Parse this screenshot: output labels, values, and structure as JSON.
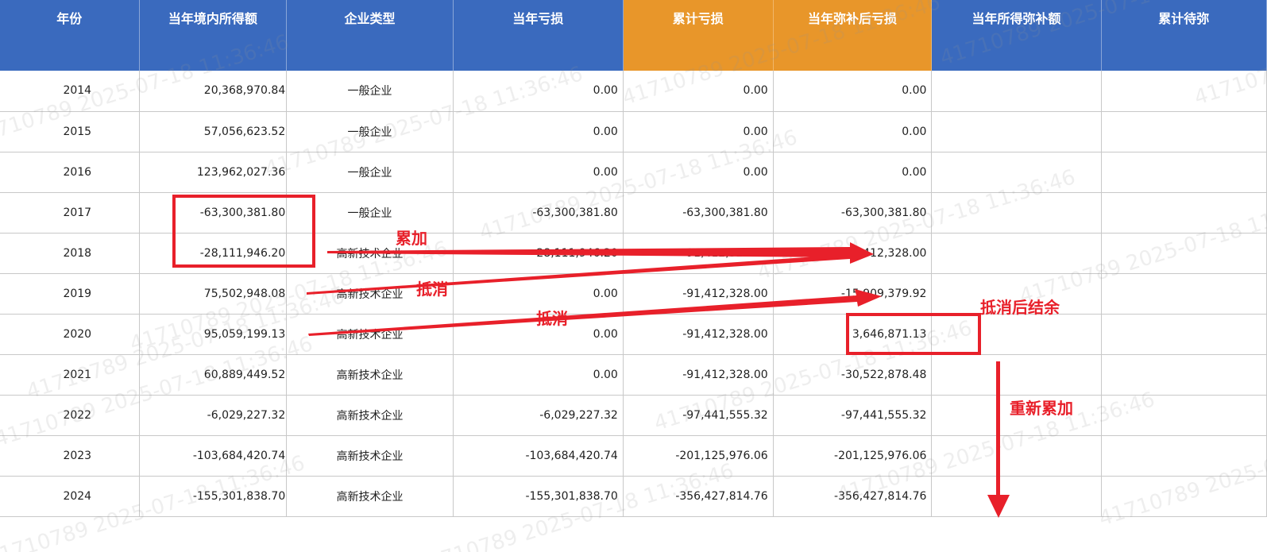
{
  "table": {
    "headers": [
      {
        "label": "年份",
        "style": "blue"
      },
      {
        "label": "当年境内所得额",
        "style": "blue"
      },
      {
        "label": "企业类型",
        "style": "blue"
      },
      {
        "label": "当年亏损",
        "style": "blue"
      },
      {
        "label": "累计亏损",
        "style": "orange"
      },
      {
        "label": "当年弥补后亏损",
        "style": "orange"
      },
      {
        "label": "当年所得弥补额",
        "style": "blue"
      },
      {
        "label": "累计待弥",
        "style": "blue"
      }
    ],
    "rows": [
      {
        "year": "2014",
        "income": "20,368,970.84",
        "type": "一般企业",
        "loss": "0.00",
        "cum_loss": "0.00",
        "after_loss": "0.00"
      },
      {
        "year": "2015",
        "income": "57,056,623.52",
        "type": "一般企业",
        "loss": "0.00",
        "cum_loss": "0.00",
        "after_loss": "0.00"
      },
      {
        "year": "2016",
        "income": "123,962,027.36",
        "type": "一般企业",
        "loss": "0.00",
        "cum_loss": "0.00",
        "after_loss": "0.00"
      },
      {
        "year": "2017",
        "income": "-63,300,381.80",
        "type": "一般企业",
        "loss": "-63,300,381.80",
        "cum_loss": "-63,300,381.80",
        "after_loss": "-63,300,381.80"
      },
      {
        "year": "2018",
        "income": "-28,111,946.20",
        "type": "高新技术企业",
        "loss": "-28,111,946.20",
        "cum_loss": "-91,412,328.00",
        "after_loss": "-91,412,328.00"
      },
      {
        "year": "2019",
        "income": "75,502,948.08",
        "type": "高新技术企业",
        "loss": "0.00",
        "cum_loss": "-91,412,328.00",
        "after_loss": "-15,909,379.92"
      },
      {
        "year": "2020",
        "income": "95,059,199.13",
        "type": "高新技术企业",
        "loss": "0.00",
        "cum_loss": "-91,412,328.00",
        "after_loss": "3,646,871.13"
      },
      {
        "year": "2021",
        "income": "60,889,449.52",
        "type": "高新技术企业",
        "loss": "0.00",
        "cum_loss": "-91,412,328.00",
        "after_loss": "-30,522,878.48"
      },
      {
        "year": "2022",
        "income": "-6,029,227.32",
        "type": "高新技术企业",
        "loss": "-6,029,227.32",
        "cum_loss": "-97,441,555.32",
        "after_loss": "-97,441,555.32"
      },
      {
        "year": "2023",
        "income": "-103,684,420.74",
        "type": "高新技术企业",
        "loss": "-103,684,420.74",
        "cum_loss": "-201,125,976.06",
        "after_loss": "-201,125,976.06"
      },
      {
        "year": "2024",
        "income": "-155,301,838.70",
        "type": "高新技术企业",
        "loss": "-155,301,838.70",
        "cum_loss": "-356,427,814.76",
        "after_loss": "-356,427,814.76"
      }
    ]
  },
  "annotations": {
    "accumulate": "累加",
    "offset_1": "抵消",
    "offset_2": "抵消",
    "remainder": "抵消后结余",
    "reaccumulate": "重新累加",
    "color": "#e8202a"
  },
  "watermark": {
    "text": "41710789 2025-07-18 11:36:46",
    "color": "#969696"
  },
  "colors": {
    "header_blue": "#3a6abe",
    "header_orange": "#e8962a"
  }
}
